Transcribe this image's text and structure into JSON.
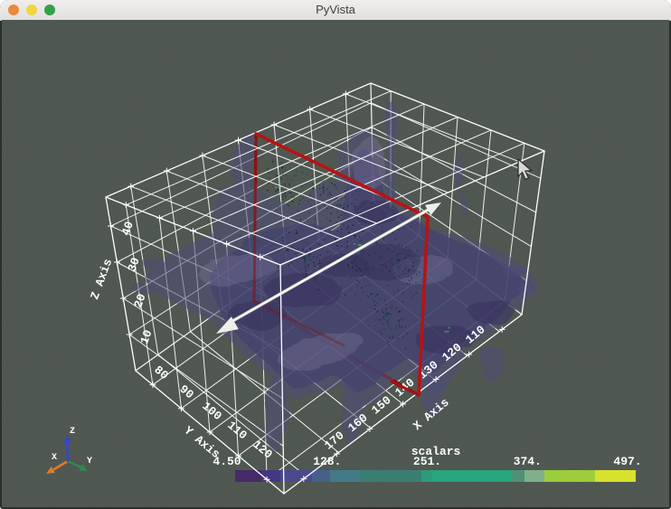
{
  "window": {
    "title": "PyVista",
    "buttons": [
      {
        "name": "close",
        "color": "#ea8a3a"
      },
      {
        "name": "minimize",
        "color": "#eed63f"
      },
      {
        "name": "zoom",
        "color": "#32a04a"
      }
    ]
  },
  "scene": {
    "background_checker": [
      "#49514b",
      "#565e57"
    ],
    "grid_color": "#ffffff",
    "axes": {
      "x": {
        "label": "X Axis",
        "ticks": [
          "170",
          "160",
          "150",
          "140",
          "130",
          "120",
          "110"
        ]
      },
      "y": {
        "label": "Y Axis",
        "ticks": [
          "80",
          "90",
          "100",
          "110",
          "120"
        ]
      },
      "z": {
        "label": "Z Axis",
        "ticks": [
          "10",
          "20",
          "30",
          "40"
        ]
      }
    },
    "scalar_bar": {
      "title": "scalars",
      "labels": [
        "4.50",
        "128.",
        "251.",
        "374.",
        "497."
      ],
      "segments": [
        {
          "color": "#472a68",
          "width": 29
        },
        {
          "color": "#453781",
          "width": 21
        },
        {
          "color": "#4b4a8e",
          "width": 35
        },
        {
          "color": "#46608a",
          "width": 20
        },
        {
          "color": "#427a87",
          "width": 33
        },
        {
          "color": "#3a7e73",
          "width": 68
        },
        {
          "color": "#2f9a79",
          "width": 12
        },
        {
          "color": "#27a57e",
          "width": 87
        },
        {
          "color": "#4f9077",
          "width": 15
        },
        {
          "color": "#7fb08b",
          "width": 22
        },
        {
          "color": "#9ecd3b",
          "width": 56
        },
        {
          "color": "#d6e22e",
          "width": 45
        }
      ]
    },
    "plane_widget": {
      "edge_color": "#b81313",
      "hidden_edge_color": "#8f1010",
      "arrow_color": "#efefe9"
    },
    "mesh": {
      "base_color": "#4f4c77",
      "core_color": "#454270",
      "mid_color": "#6b68a0",
      "light_color": "#908daf",
      "dark_color": "#343259",
      "speckle_colors": [
        "#16222e",
        "#113c44",
        "#0d4a42",
        "#1c2c4a"
      ],
      "green_color": "#45b15e"
    },
    "orientation_axes": {
      "x": {
        "label": "X",
        "color": "#e07b28"
      },
      "y": {
        "label": "Y",
        "color": "#2e8b4a"
      },
      "z": {
        "label": "Z",
        "color": "#3647c8"
      }
    }
  }
}
